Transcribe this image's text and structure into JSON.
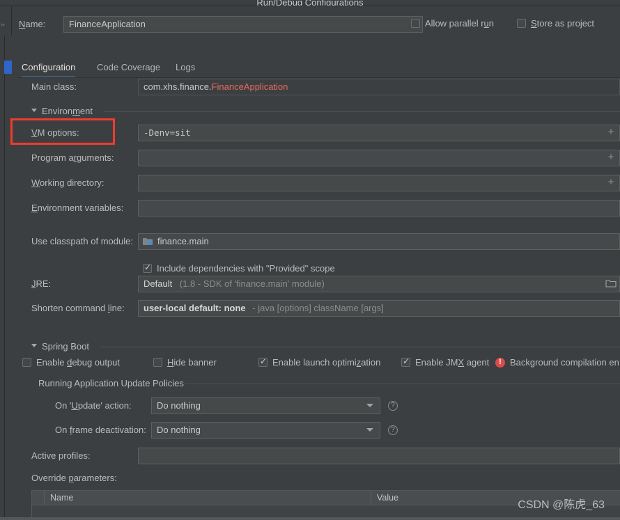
{
  "window": {
    "title": "Run/Debug Configurations"
  },
  "name_row": {
    "label": "Name:",
    "label_mnemonic": "N",
    "value": "FinanceApplication",
    "checkboxes": [
      {
        "label": "Allow parallel run",
        "checked": false,
        "name": "allow-parallel-run-checkbox"
      },
      {
        "label": "Store as project",
        "checked": false,
        "name": "store-as-project-checkbox"
      }
    ]
  },
  "tabs": [
    {
      "label": "Configuration",
      "active": true
    },
    {
      "label": "Code Coverage",
      "active": false
    },
    {
      "label": "Logs",
      "active": false
    }
  ],
  "main_class": {
    "label": "Main class:",
    "package": "com.xhs.finance.",
    "class_name": "FinanceApplication",
    "class_color": "#e86b5e"
  },
  "environment_section": {
    "title": "Environment",
    "expanded": true,
    "fields": [
      {
        "label": "VM options:",
        "value": "-Denv=sit",
        "mono": true,
        "expand_icon": "plus-icon",
        "name": "vm-options"
      },
      {
        "label": "Program arguments:",
        "value": "",
        "mono": false,
        "expand_icon": "plus-icon",
        "name": "program-arguments"
      },
      {
        "label": "Working directory:",
        "value": "",
        "mono": false,
        "expand_icon": "plus-icon",
        "name": "working-directory"
      },
      {
        "label": "Environment variables:",
        "value": "",
        "mono": false,
        "expand_icon": "",
        "name": "environment-variables"
      }
    ]
  },
  "classpath": {
    "label": "Use classpath of module:",
    "module": "finance.main",
    "module_icon": "module-folder-icon",
    "include_provided": {
      "label": "Include dependencies with \"Provided\" scope",
      "checked": true
    }
  },
  "jre": {
    "label": "JRE:",
    "value": "Default",
    "hint": "(1.8 - SDK of 'finance.main' module)",
    "browse_icon": "folder-icon"
  },
  "shorten_command_line": {
    "label": "Shorten command line:",
    "value": "user-local default: none",
    "hint": "- java [options] className [args]"
  },
  "spring_boot_section": {
    "title": "Spring Boot",
    "expanded": true,
    "checkboxes": [
      {
        "label": "Enable debug output",
        "checked": false,
        "name": "enable-debug-output-checkbox"
      },
      {
        "label": "Hide banner",
        "checked": false,
        "name": "hide-banner-checkbox"
      },
      {
        "label": "Enable launch optimization",
        "checked": true,
        "name": "enable-launch-optimization-checkbox"
      },
      {
        "label": "Enable JMX agent",
        "checked": true,
        "name": "enable-jmx-agent-checkbox"
      }
    ],
    "warning": {
      "icon": "error-circle-icon",
      "text": "Background compilation en",
      "color": "#db4b4b"
    },
    "update_policies": {
      "title": "Running Application Update Policies",
      "rows": [
        {
          "label": "On 'Update' action:",
          "value": "Do nothing",
          "help": "?",
          "name": "on-update-action"
        },
        {
          "label": "On frame deactivation:",
          "value": "Do nothing",
          "help": "?",
          "name": "on-frame-deactivation"
        }
      ]
    }
  },
  "active_profiles": {
    "label": "Active profiles:",
    "value": ""
  },
  "override_parameters": {
    "label": "Override parameters:",
    "columns": [
      "Name",
      "Value"
    ],
    "rows": []
  },
  "annotation": {
    "type": "red-highlight-box",
    "target": "VM options:",
    "color": "#f03c2e"
  },
  "watermark": {
    "text": "CSDN @陈虎_63"
  }
}
